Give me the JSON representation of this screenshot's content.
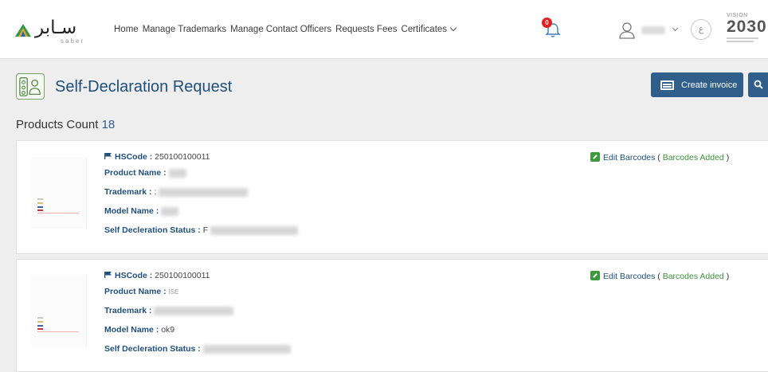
{
  "header": {
    "logo_arabic": "سـابر",
    "logo_latin": "saber",
    "nav": [
      "Home",
      "Manage Trademarks",
      "Manage Contact Officers",
      "Requests Fees",
      "Certificates"
    ],
    "notification_count": "0",
    "language_toggle": "ع",
    "vision_caption": "VISION",
    "vision_year": "2030"
  },
  "page": {
    "title": "Self-Declaration Request",
    "create_invoice_label": "Create invoice",
    "products_count_label": "Products Count",
    "products_count": "18"
  },
  "labels": {
    "hscode": "HSCode :",
    "product_name": "Product Name :",
    "trademark": "Trademark :",
    "model_name": "Model Name :",
    "status": "Self Decleration Status :",
    "edit_barcodes": "Edit Barcodes",
    "barcodes_added": "Barcodes Added"
  },
  "products": [
    {
      "hscode": "250100100011",
      "product_name": "",
      "trademark": ":",
      "model_name": "",
      "status": "F"
    },
    {
      "hscode": "250100100011",
      "product_name": "ISE",
      "trademark": "",
      "model_name": "ok9",
      "status": ""
    }
  ],
  "colors": {
    "primary": "#2f5e8b",
    "label_blue": "#1f4f7a",
    "success_green": "#3c8f3c",
    "badge_red": "#e02020"
  }
}
